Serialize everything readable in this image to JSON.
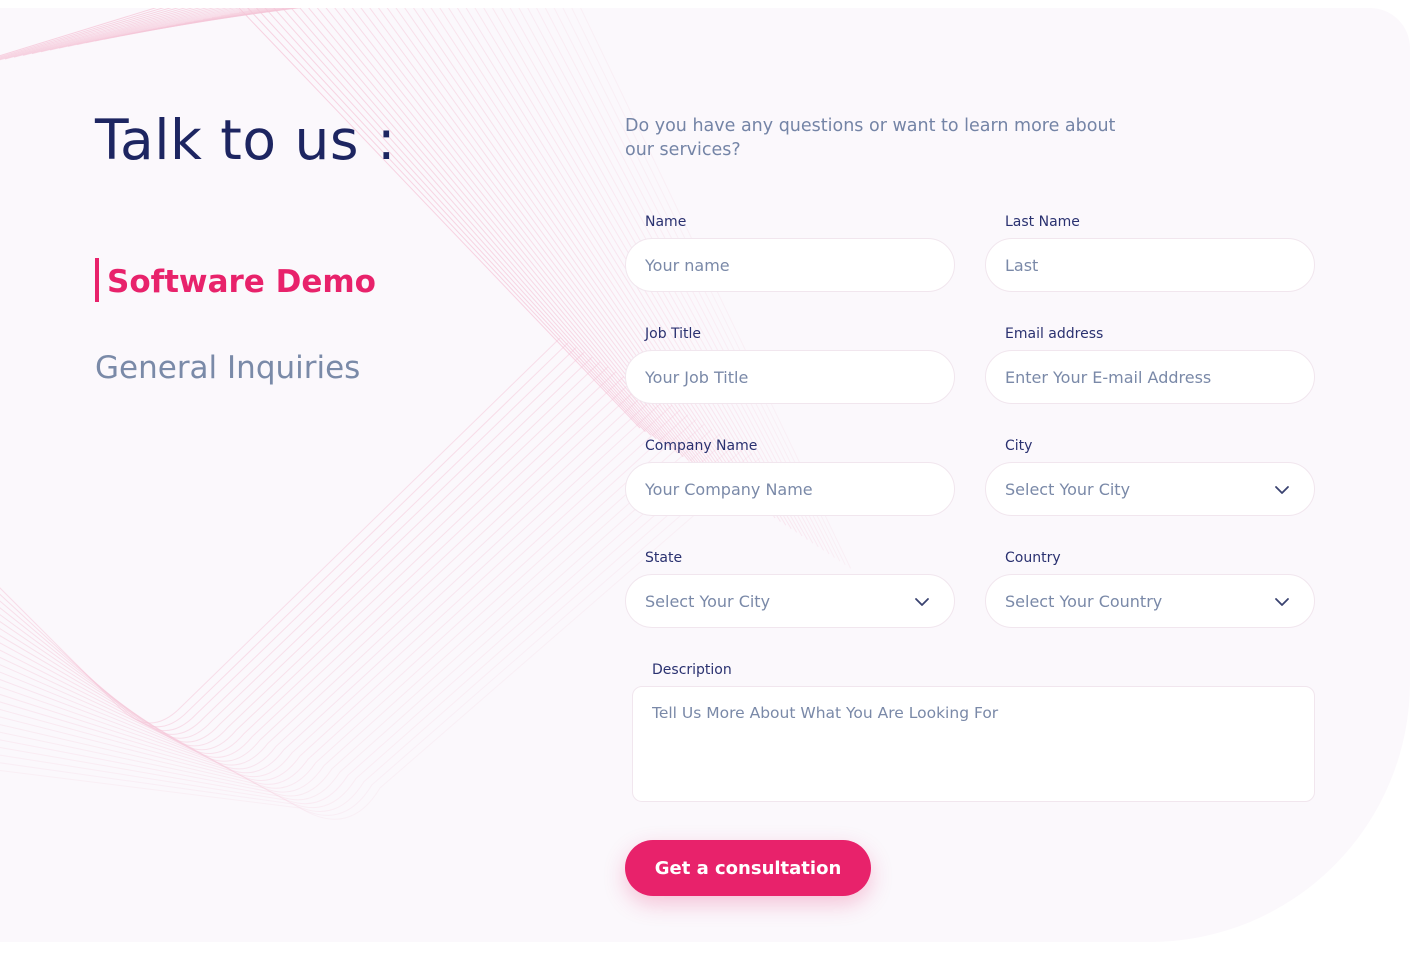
{
  "heading": "Talk to us :",
  "tabs": {
    "active": "Software Demo",
    "inactive": "General Inquiries"
  },
  "intro": "Do you have any questions or want to learn more about our services?",
  "form": {
    "name": {
      "label": "Name",
      "placeholder": "Your name"
    },
    "last_name": {
      "label": "Last Name",
      "placeholder": "Last"
    },
    "job_title": {
      "label": "Job Title",
      "placeholder": "Your Job Title"
    },
    "email": {
      "label": "Email address",
      "placeholder": "Enter Your E-mail Address"
    },
    "company": {
      "label": "Company Name",
      "placeholder": "Your Company Name"
    },
    "city": {
      "label": "City",
      "value": "Select Your City"
    },
    "state": {
      "label": "State",
      "value": "Select Your City"
    },
    "country": {
      "label": "Country",
      "value": "Select Your Country"
    },
    "description": {
      "label": "Description",
      "placeholder": "Tell Us More About What You Are Looking For"
    },
    "submit_label": "Get a consultation"
  },
  "colors": {
    "accent": "#e8226b",
    "heading": "#1d2561",
    "muted": "#7a8aa8",
    "panel_bg": "#fbf8fc"
  },
  "icons": {
    "select": "chevron-down-icon"
  }
}
